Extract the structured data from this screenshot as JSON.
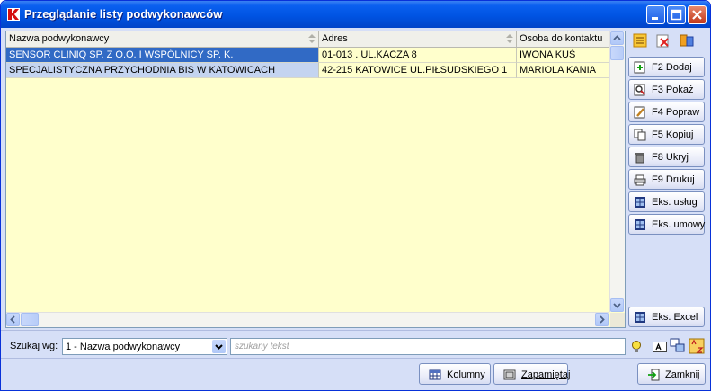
{
  "window": {
    "title": "Przeglądanie listy podwykonawców"
  },
  "grid": {
    "columns": [
      "Nazwa podwykonawcy",
      "Adres",
      "Osoba do kontaktu"
    ],
    "rows": [
      {
        "name": "SENSOR CLINIQ SP. Z O.O. I WSPÓLNICY SP. K.",
        "address": "01-013 . UL.KACZA 8",
        "contact": "IWONA KUŚ"
      },
      {
        "name": "SPECJALISTYCZNA PRZYCHODNIA BIS W KATOWICACH",
        "address": "42-215 KATOWICE UL.PIŁSUDSKIEGO 1",
        "contact": "MARIOLA KANIA"
      }
    ]
  },
  "side_buttons": {
    "add": "F2 Dodaj",
    "show": "F3 Pokaż",
    "edit": "F4 Popraw",
    "copy": "F5 Kopiuj",
    "hide": "F8 Ukryj",
    "print": "F9 Drukuj",
    "export_services": "Eks. usług",
    "export_contract": "Eks. umowy",
    "export_excel": "Eks. Excel"
  },
  "search": {
    "label": "Szukaj wg:",
    "field_value": "1 - Nazwa podwykonawcy",
    "placeholder": "szukany tekst"
  },
  "bottom": {
    "columns": "Kolumny",
    "remember": "Zapamiętaj",
    "close": "Zamknij"
  },
  "colors": {
    "selection": "#316ac5",
    "grid_background": "#ffffcc",
    "window_background": "#d6dff7",
    "titlebar": "#0054e3"
  }
}
